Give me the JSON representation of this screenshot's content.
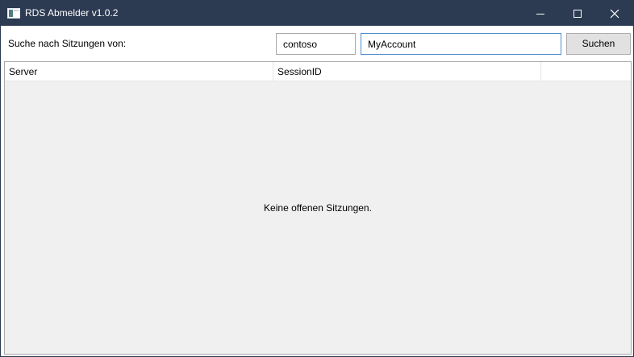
{
  "window": {
    "title": "RDS Abmelder v1.0.2",
    "icon": "app-window-icon",
    "controls": [
      "minimize-icon",
      "maximize-icon",
      "close-icon"
    ]
  },
  "search": {
    "label": "Suche nach Sitzungen von:",
    "domain_value": "contoso",
    "account_value": "MyAccount",
    "button_label": "Suchen"
  },
  "sessions": {
    "columns": [
      "Server",
      "SessionID",
      ""
    ],
    "rows": [],
    "empty_message": "Keine offenen Sitzungen."
  },
  "colors": {
    "titlebar": "#2c3a52",
    "list_background": "#f0f0f0",
    "focus_border": "#4d8fce"
  }
}
